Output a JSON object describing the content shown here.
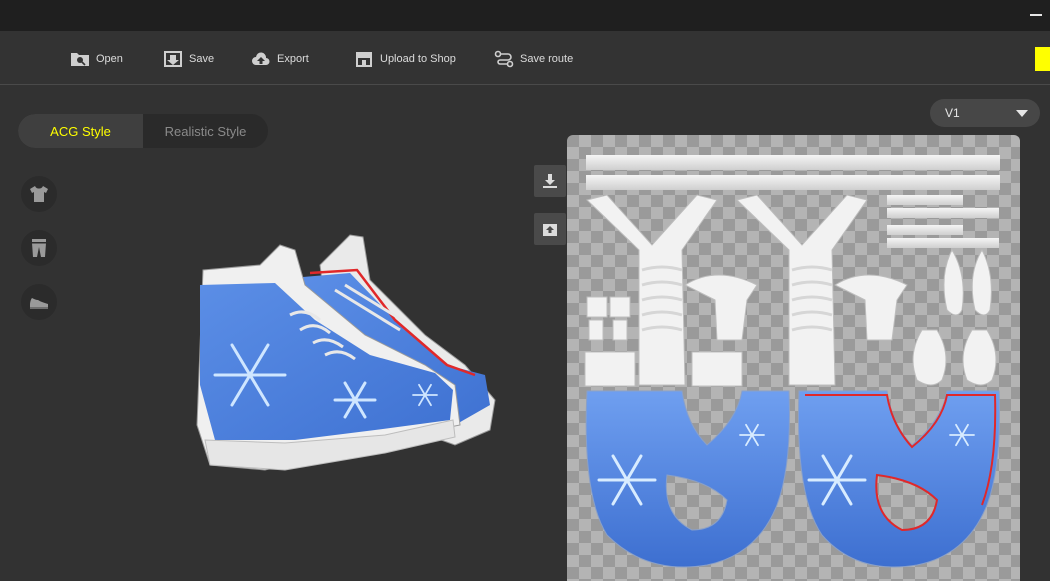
{
  "toolbar": {
    "open": "Open",
    "save": "Save",
    "export": "Export",
    "upload": "Upload to Shop",
    "save_route": "Save route"
  },
  "style_toggle": {
    "acg": "ACG Style",
    "realistic": "Realistic Style",
    "selected": "ACG Style"
  },
  "categories": [
    "shirt-icon",
    "pants-icon",
    "shoe-icon"
  ],
  "version": {
    "selected": "V1"
  },
  "colors": {
    "accent": "#ffff00",
    "background": "#323232",
    "titlebar": "#1f1f1f",
    "texture_blue": "#4a7fdc",
    "seam_red": "#e0282a"
  }
}
